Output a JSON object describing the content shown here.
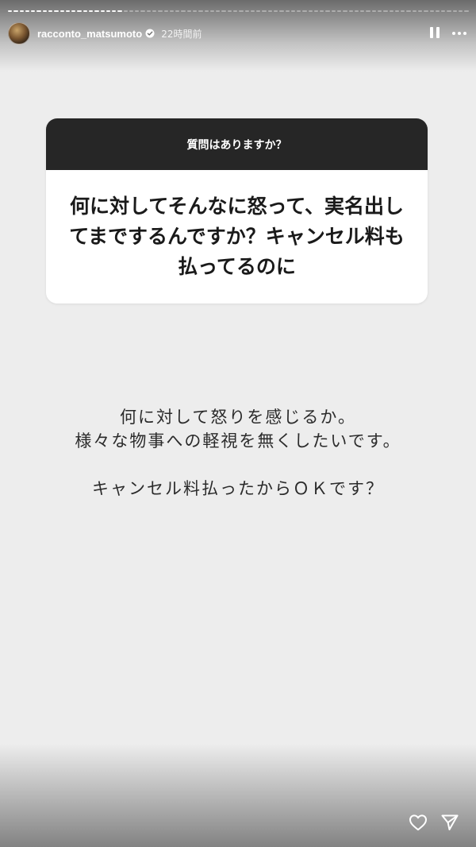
{
  "story": {
    "progress_segments": [
      1,
      1,
      1,
      1,
      1,
      1,
      1,
      1,
      1,
      1,
      1,
      1,
      1,
      1,
      1,
      1,
      1,
      1,
      1,
      1,
      0,
      0,
      0,
      0,
      0,
      0,
      0,
      0,
      0,
      0,
      0,
      0,
      0,
      0,
      0,
      0,
      0,
      0,
      0,
      0,
      0,
      0,
      0,
      0,
      0,
      0,
      0,
      0,
      0,
      0,
      0,
      0,
      0,
      0,
      0,
      0,
      0,
      0,
      0,
      0,
      0,
      0,
      0,
      0,
      0,
      0,
      0,
      0,
      0,
      0,
      0,
      0,
      0,
      0,
      0,
      0,
      0,
      0,
      0,
      0
    ],
    "header": {
      "username": "racconto_matsumoto",
      "verified": true,
      "timestamp": "22時間前",
      "icons": [
        "pause-icon",
        "more-icon",
        "verified-badge-icon"
      ]
    },
    "question_sticker": {
      "prompt": "質問はありますか？",
      "question": "何に対してそんなに怒って、実名出してまでするんですか？キャンセル料も払ってるのに"
    },
    "answer": {
      "line1": "何に対して怒りを感じるか。",
      "line2": "様々な物事への軽視を無くしたいです。",
      "line3": "キャンセル料払ったからＯＫです？"
    },
    "bottom_actions": {
      "icons": [
        "heart-icon",
        "send-icon"
      ]
    },
    "colors": {
      "background": "#ededed",
      "sticker_header": "#262626",
      "sticker_body": "#ffffff",
      "answer_text": "#2b2b2b"
    }
  }
}
